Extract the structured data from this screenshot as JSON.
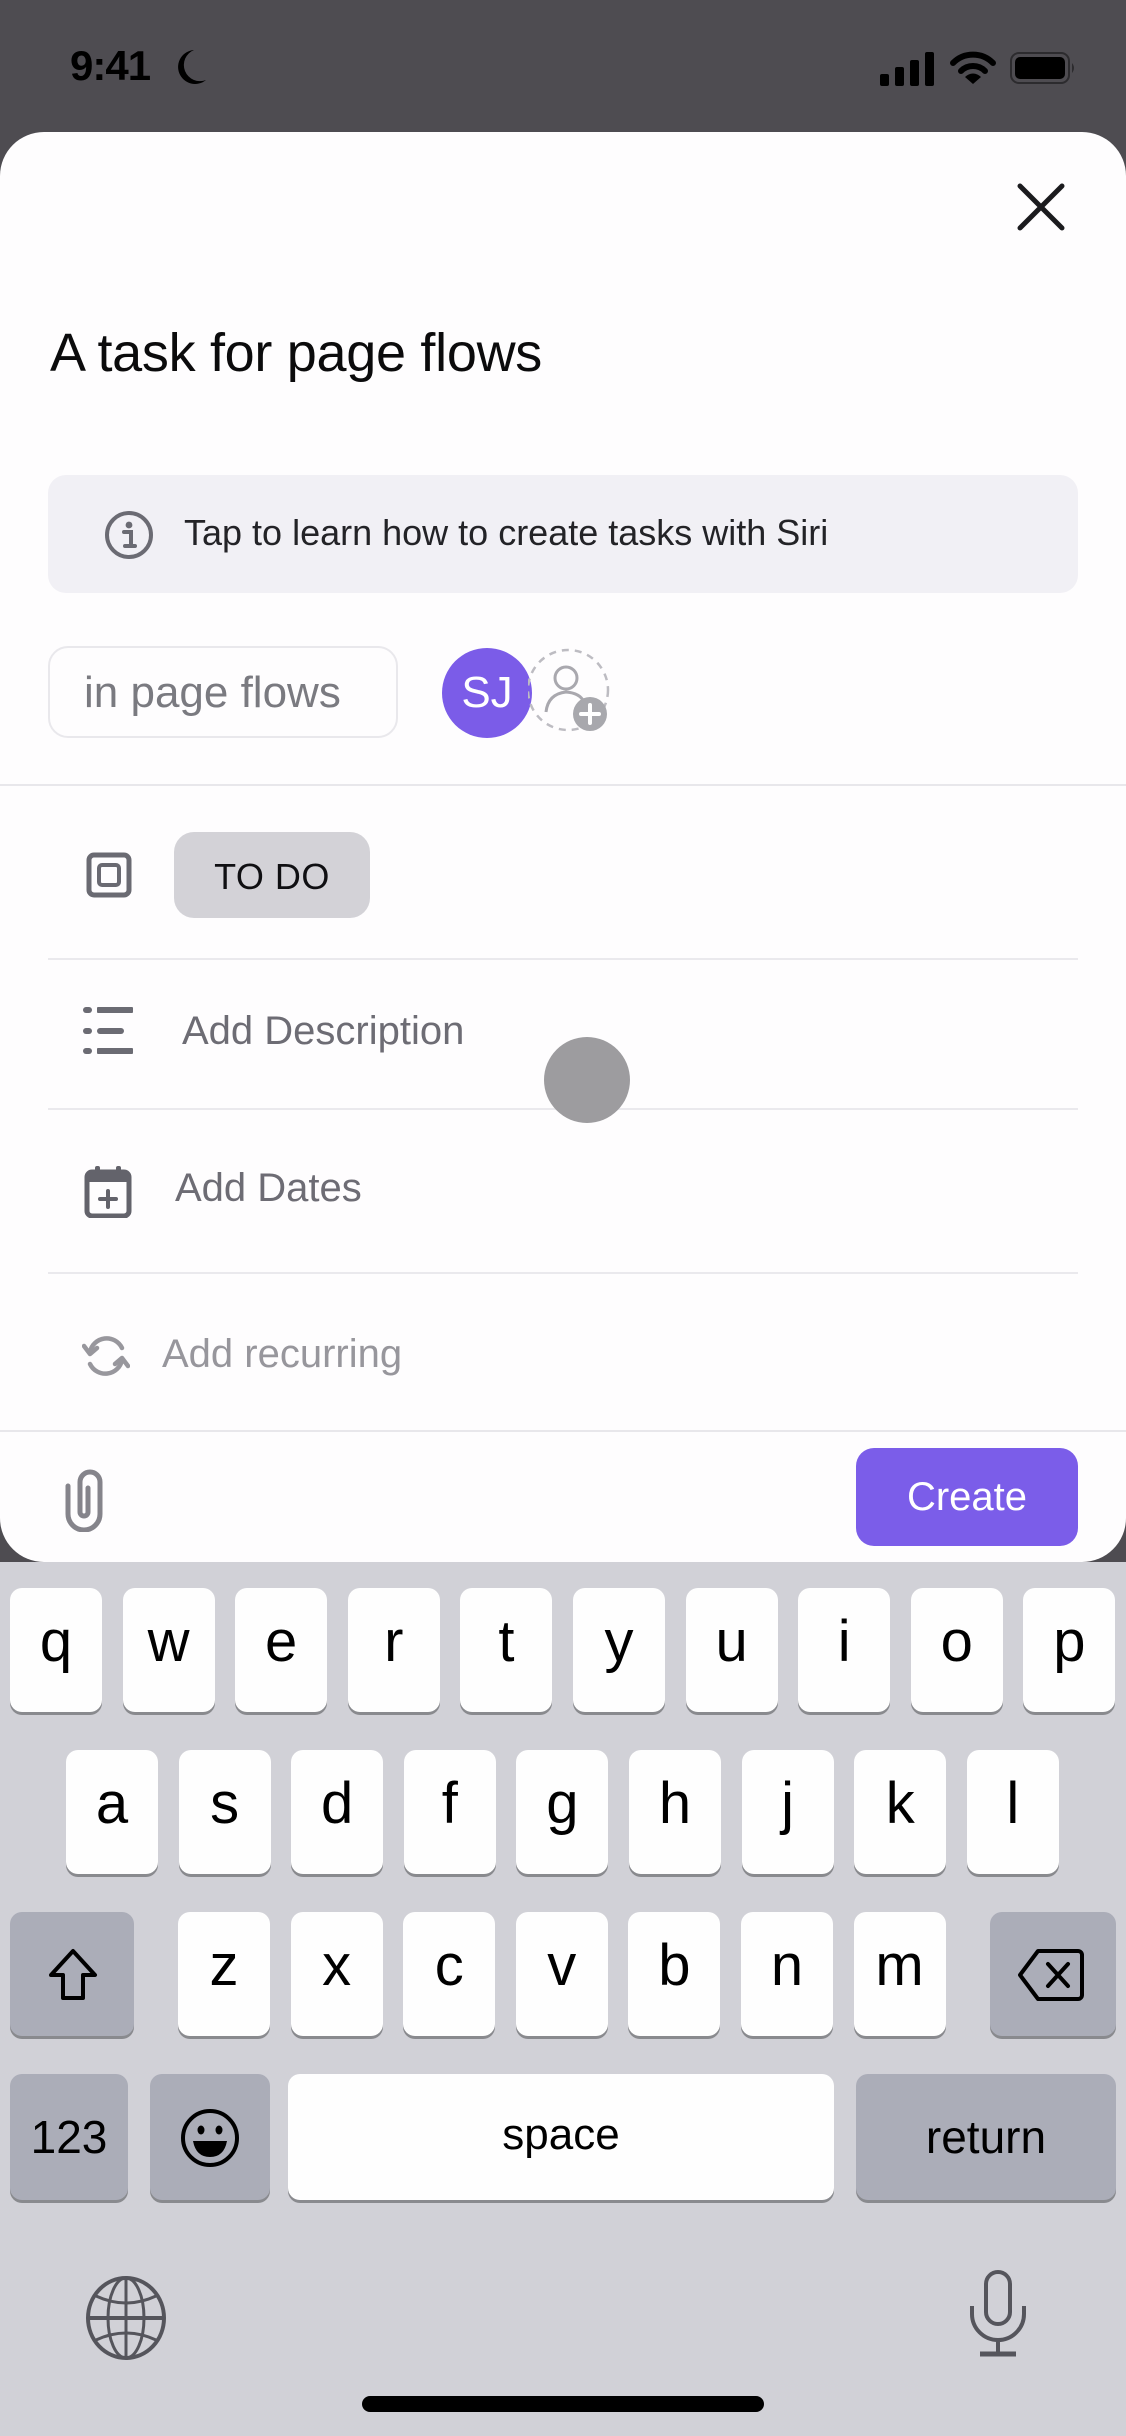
{
  "status_bar": {
    "time": "9:41",
    "focus_icon": "moon-icon",
    "right_icons": [
      "cellular-signal-icon",
      "wifi-icon",
      "battery-icon"
    ]
  },
  "sheet": {
    "close_icon": "close-icon",
    "task_title": "A task for page flows",
    "siri_banner": {
      "icon": "info-icon",
      "text": "Tap to learn how to create tasks with Siri"
    },
    "list_chip": "in page flows",
    "assignee": {
      "initials": "SJ",
      "color": "#7b5ce8"
    },
    "add_assignee_icon": "add-user-icon",
    "status": {
      "icon": "status-square-icon",
      "label": "TO DO"
    },
    "rows": [
      {
        "icon": "list-icon",
        "label": "Add Description"
      },
      {
        "icon": "calendar-plus-icon",
        "label": "Add Dates"
      },
      {
        "icon": "recurring-icon",
        "label": "Add recurring"
      }
    ],
    "footer": {
      "attach_icon": "paperclip-icon",
      "create_label": "Create",
      "accent_color": "#7b5de9"
    }
  },
  "keyboard": {
    "row1": [
      "q",
      "w",
      "e",
      "r",
      "t",
      "y",
      "u",
      "i",
      "o",
      "p"
    ],
    "row2": [
      "a",
      "s",
      "d",
      "f",
      "g",
      "h",
      "j",
      "k",
      "l"
    ],
    "row3": [
      "z",
      "x",
      "c",
      "v",
      "b",
      "n",
      "m"
    ],
    "shift_icon": "shift-icon",
    "delete_icon": "delete-icon",
    "numbers_label": "123",
    "emoji_icon": "emoji-icon",
    "space_label": "space",
    "return_label": "return",
    "globe_icon": "globe-icon",
    "mic_icon": "microphone-icon"
  }
}
